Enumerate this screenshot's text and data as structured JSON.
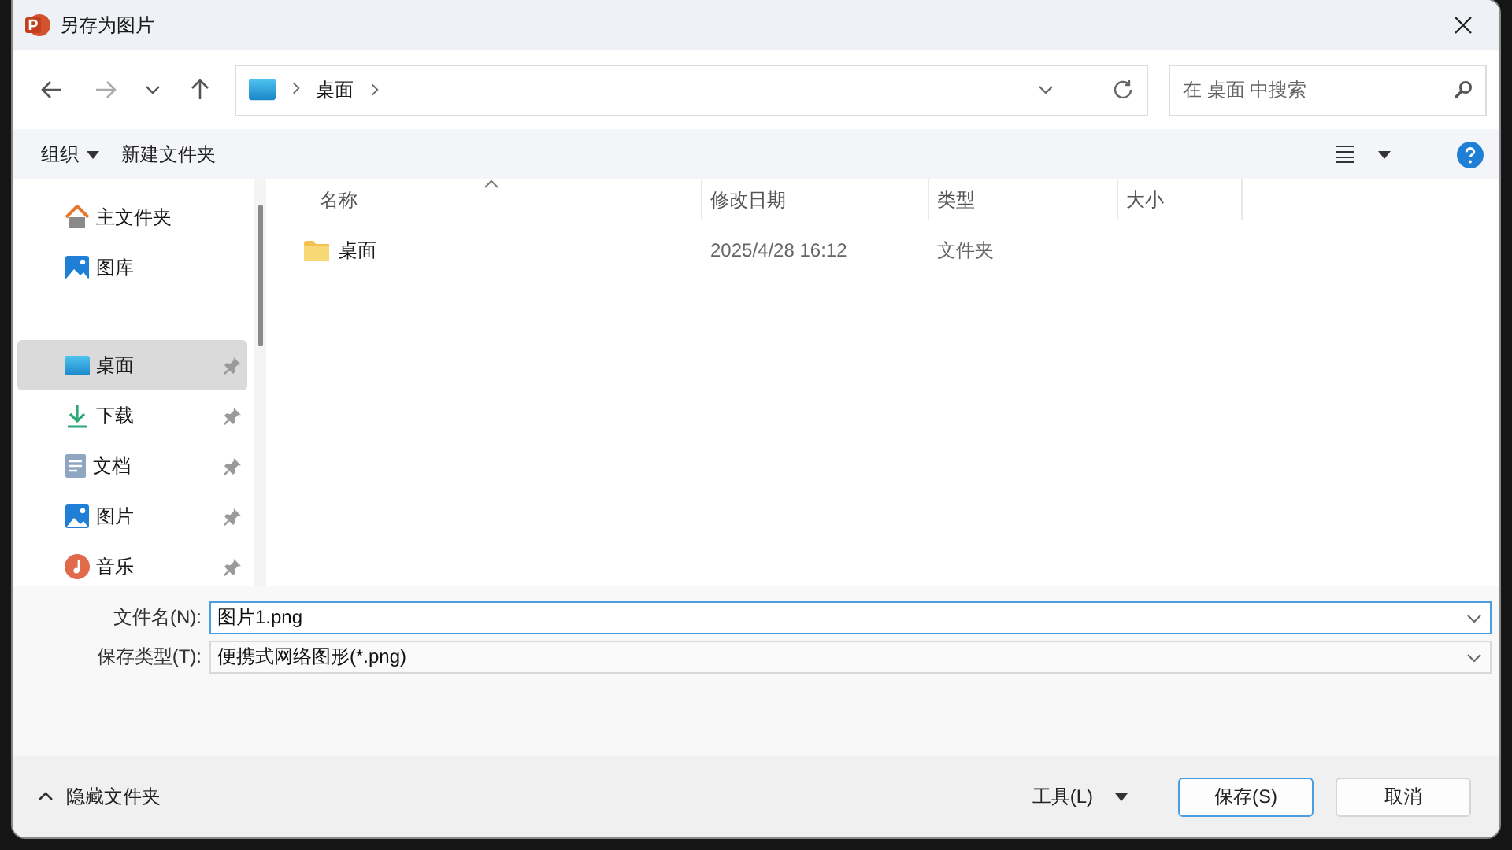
{
  "window": {
    "title": "另存为图片"
  },
  "nav": {
    "breadcrumb": [
      "桌面"
    ],
    "search": {
      "placeholder": "在 桌面 中搜索"
    }
  },
  "commands": [
    {
      "label": "组织",
      "dropdown": true
    },
    {
      "label": "新建文件夹",
      "dropdown": false
    }
  ],
  "sidebar": {
    "groups": [
      [
        {
          "label": "主文件夹",
          "kind": "home",
          "pinned": false,
          "selected": false
        },
        {
          "label": "图库",
          "kind": "gallery",
          "pinned": false,
          "selected": false
        }
      ],
      [
        {
          "label": "桌面",
          "kind": "desktop",
          "pinned": true,
          "selected": true
        },
        {
          "label": "下载",
          "kind": "download",
          "pinned": true,
          "selected": false
        },
        {
          "label": "文档",
          "kind": "document",
          "pinned": true,
          "selected": false
        },
        {
          "label": "图片",
          "kind": "picture",
          "pinned": true,
          "selected": false
        },
        {
          "label": "音乐",
          "kind": "music",
          "pinned": true,
          "selected": false
        }
      ]
    ]
  },
  "table": {
    "columns": [
      {
        "label": "名称",
        "sorted": true
      },
      {
        "label": "修改日期",
        "sorted": false
      },
      {
        "label": "类型",
        "sorted": false
      },
      {
        "label": "大小",
        "sorted": false
      }
    ],
    "rows": [
      {
        "name": "桌面",
        "modified": "2025/4/28 16:12",
        "type": "文件夹"
      }
    ]
  },
  "form": {
    "fields": [
      {
        "label": "文件名(N):",
        "value": "图片1.png",
        "focused": true
      },
      {
        "label": "保存类型(T):",
        "value": "便携式网络图形(*.png)",
        "focused": false
      }
    ]
  },
  "footer": {
    "toggle": "隐藏文件夹",
    "tools": "工具(L)",
    "buttons": [
      {
        "label": "保存(S)",
        "default": true
      },
      {
        "label": "取消",
        "default": false
      }
    ]
  }
}
